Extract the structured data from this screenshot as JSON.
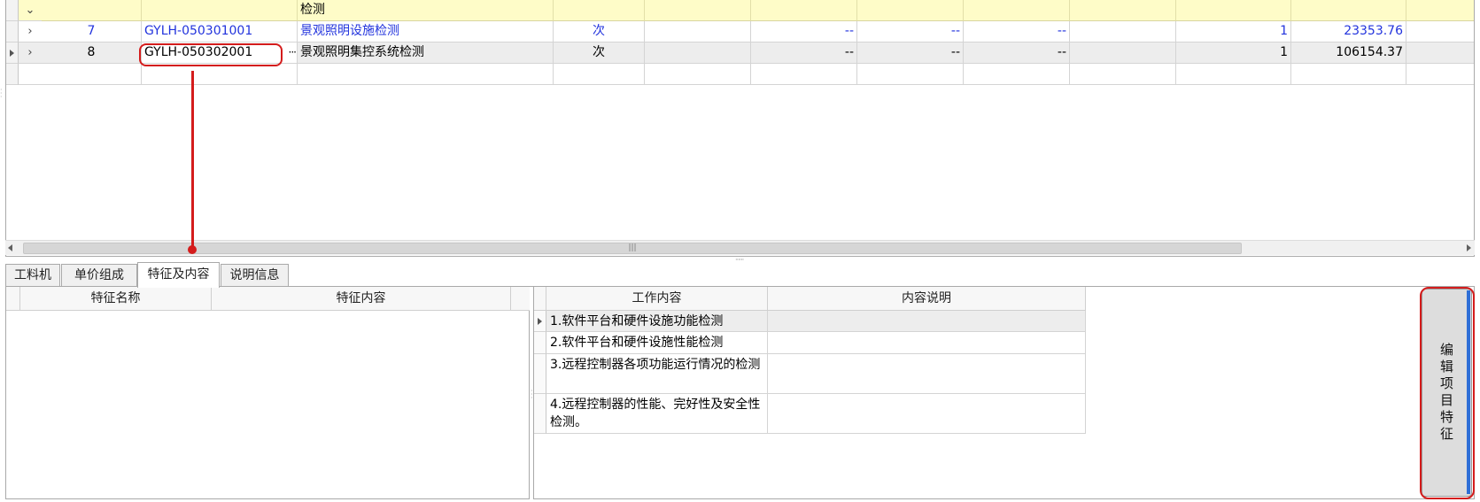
{
  "grid": {
    "group_row": {
      "name": "检测"
    },
    "rows": [
      {
        "index": "7",
        "code": "GYLH-050301001",
        "name": "景观照明设施检测",
        "unit": "次",
        "dash1": "--",
        "dash2": "--",
        "dash3": "--",
        "qty": "1",
        "amount": "23353.76"
      },
      {
        "index": "8",
        "code": "GYLH-050302001",
        "name": "景观照明集控系统检测",
        "unit": "次",
        "dash1": "--",
        "dash2": "--",
        "dash3": "--",
        "qty": "1",
        "amount": "106154.37",
        "ellipsis": "···"
      }
    ],
    "scroll_grip": "|||",
    "splitter_grip": "······"
  },
  "tabs": [
    {
      "label": "工料机"
    },
    {
      "label": "单价组成"
    },
    {
      "label": "特征及内容",
      "active": true
    },
    {
      "label": "说明信息"
    }
  ],
  "features": {
    "columns": [
      "特征名称",
      "特征内容"
    ]
  },
  "work": {
    "columns": [
      "工作内容",
      "内容说明"
    ],
    "rows": [
      {
        "content": "1.软件平台和硬件设施功能检测",
        "note": ""
      },
      {
        "content": "2.软件平台和硬件设施性能检测",
        "note": ""
      },
      {
        "content": "3.远程控制器各项功能运行情况的检测",
        "note": ""
      },
      {
        "content": "4.远程控制器的性能、完好性及安全性检测。",
        "note": ""
      }
    ]
  },
  "edit_button": {
    "label": "编辑项目特征"
  },
  "colors": {
    "highlight_red": "#d41c1c",
    "link_blue": "#2233dd",
    "group_yellow": "#fefcc8"
  }
}
